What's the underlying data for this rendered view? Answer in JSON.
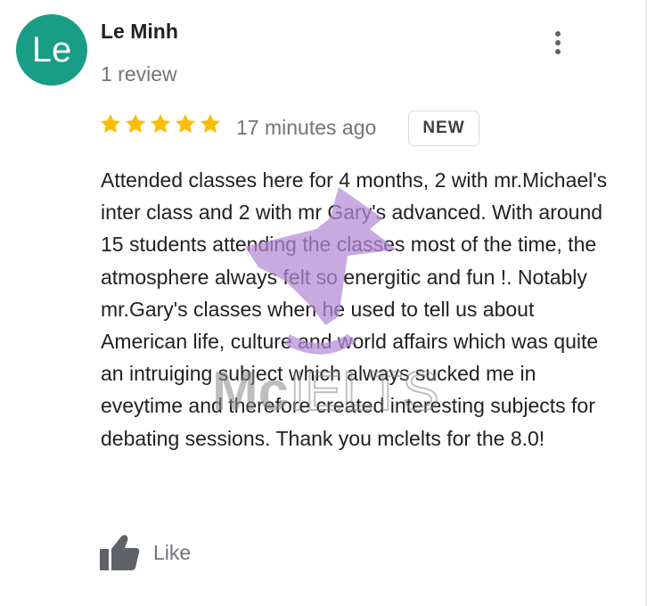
{
  "reviewer": {
    "initials": "Le",
    "name": "Le Minh",
    "review_count": "1 review"
  },
  "rating": {
    "stars": 5,
    "max": 5,
    "color": "#fbbc04"
  },
  "review": {
    "time_ago": "17 minutes ago",
    "badge": "NEW",
    "text": "Attended classes here for 4 months, 2 with mr.Michael's inter class and 2 with mr Gary's advanced. With around 15 students attending the classes most of the time, the atmosphere always felt so energitic and fun !. Notably mr.Gary's classes when he used to tell us about American life, culture and world affairs which was quite an intruiging subject which always sucked me in eveytime and therefore created interesting subjects for debating sessions. Thank you mclelts for the 8.0!"
  },
  "actions": {
    "like_label": "Like"
  },
  "watermark": {
    "text_mc": "Mc",
    "text_ielts": "IELTS"
  },
  "colors": {
    "avatar_bg": "#1a9d86",
    "text_primary": "#202124",
    "text_secondary": "#70757a",
    "icon_gray": "#5f6368",
    "watermark_purple": "#b48ad6"
  },
  "icons": {
    "more": "more-vert-icon",
    "star": "star-icon",
    "like": "thumbs-up-icon"
  }
}
